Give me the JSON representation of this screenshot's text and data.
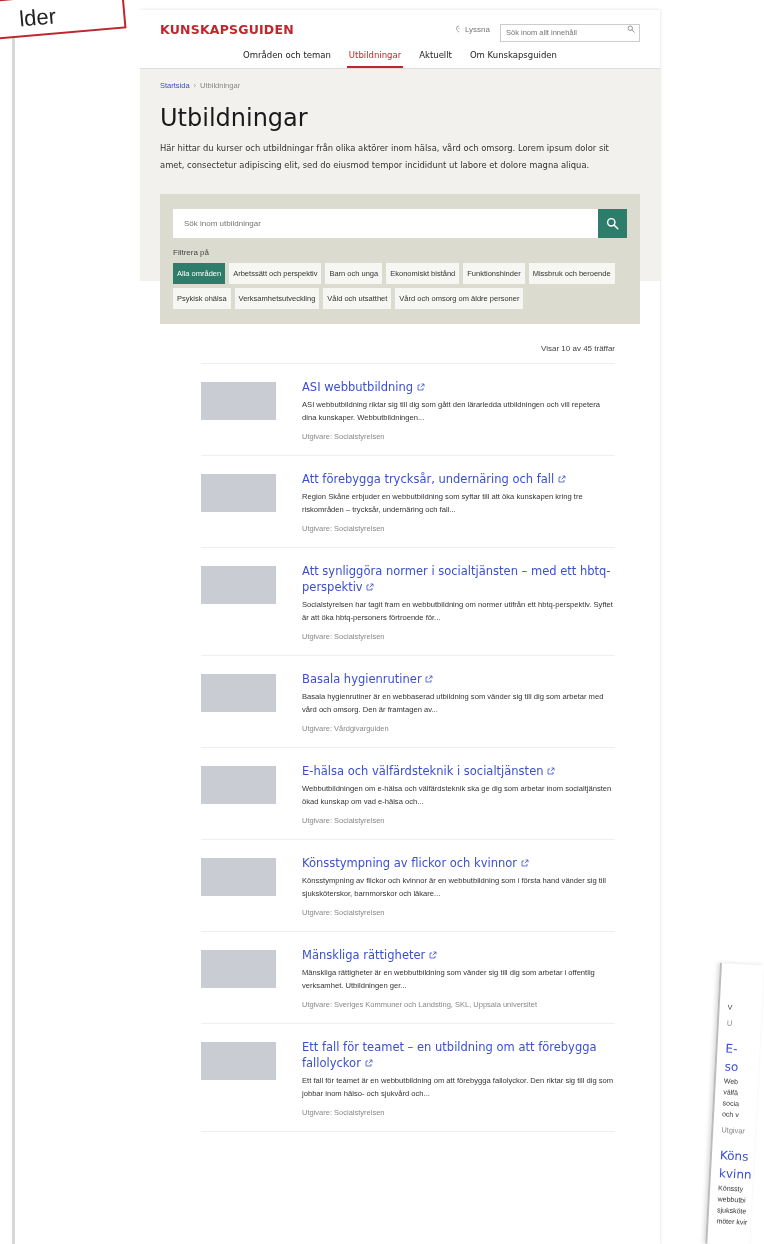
{
  "callout": {
    "text": "lder"
  },
  "header": {
    "logo": "KUNSKAPSGUIDEN",
    "listen": "Lyssna",
    "search": {
      "placeholder": "Sök inom allt innehåll"
    },
    "nav": [
      {
        "label": "Områden och teman",
        "selected": false
      },
      {
        "label": "Utbildningar",
        "selected": true
      },
      {
        "label": "Aktuellt",
        "selected": false
      },
      {
        "label": "Om Kunskapsguiden",
        "selected": false
      }
    ]
  },
  "breadcrumb": {
    "separator": "›",
    "items": [
      {
        "label": "Startsida",
        "current": false
      },
      {
        "label": "Utbildningar",
        "current": true
      }
    ]
  },
  "title": "Utbildningar",
  "intro": "Här hittar du kurser och utbildningar från olika aktörer inom hälsa, vård och omsorg. Lorem ipsum dolor sit amet, consectetur adipiscing elit, sed do eiusmod tempor incididunt ut labore et dolore magna aliqua.",
  "filter": {
    "search": {
      "placeholder": "Sök inom utbildningar"
    },
    "label": "Filtrera på",
    "chips": [
      {
        "label": "Alla områden",
        "selected": true
      },
      {
        "label": "Arbetssätt och perspektiv",
        "selected": false
      },
      {
        "label": "Barn och unga",
        "selected": false
      },
      {
        "label": "Ekonomiskt bistånd",
        "selected": false
      },
      {
        "label": "Funktionshinder",
        "selected": false
      },
      {
        "label": "Missbruk och beroende",
        "selected": false
      },
      {
        "label": "Psykisk ohälsa",
        "selected": false
      },
      {
        "label": "Verksamhetsutveckling",
        "selected": false
      },
      {
        "label": "Våld och utsatthet",
        "selected": false
      },
      {
        "label": "Vård och omsorg om äldre personer",
        "selected": false
      }
    ]
  },
  "results_count": "Visar 10 av 45 träffar",
  "results": [
    {
      "title": "ASI webbutbildning",
      "description": "ASI webbutbildning riktar sig till dig som gått den lärarledda utbildningen och vill repetera dina kunskaper. Webbutbildningen...",
      "publisher": "Utgivare: Socialstyrelsen"
    },
    {
      "title": "Att förebygga trycksår, undernäring och fall",
      "description": "Region Skåne erbjuder en webbutbildning som syftar till att öka kunskapen kring tre riskområden – trycksår, undernäring och fall...",
      "publisher": "Utgivare: Socialstyrelsen"
    },
    {
      "title": "Att synliggöra normer i socialtjänsten – med ett hbtq-perspektiv",
      "description": "Socialstyrelsen har tagit fram en webbutbildning om normer utifrån ett hbtq-perspektiv. Syftet är att öka hbtq-personers förtroende för...",
      "publisher": "Utgivare: Socialstyrelsen"
    },
    {
      "title": "Basala hygienrutiner",
      "description": "Basala hygienrutiner är en webbaserad utbildning som vänder sig till dig som arbetar med vård och omsorg. Den är framtagen av...",
      "publisher": "Utgivare: Vårdgivarguiden"
    },
    {
      "title": "E-hälsa och välfärdsteknik i socialtjänsten",
      "description": "Webbutbildningen om e-hälsa och välfärdsteknik ska ge dig som arbetar inom socialtjänsten ökad kunskap om vad e-hälsa och...",
      "publisher": "Utgivare: Socialstyrelsen"
    },
    {
      "title": "Könsstympning av flickor och kvinnor",
      "description": "Könsstympning av flickor och kvinnor är en webbutbildning som i första hand vänder sig till sjuksköterskor, barnmorskor och läkare...",
      "publisher": "Utgivare: Socialstyrelsen"
    },
    {
      "title": "Mänskliga rättigheter",
      "description": "Mänskliga rättigheter är en webbutbildning som vänder sig till dig som arbetar i offentlig verksamhet. Utbildningen ger...",
      "publisher": "Utgivare: Sveriges Kommuner och Landsting, SKL, Uppsala universitet"
    },
    {
      "title": "Ett fall för teamet – en utbildning om att förebygga fallolyckor",
      "description": "Ett fall för teamet är en webbutbildning om att förebygga fallolyckor. Den riktar sig till dig som jobbar inom hälso- och sjukvård och...",
      "publisher": "Utgivare: Socialstyrelsen"
    }
  ],
  "side_page": [
    {
      "kind": "text",
      "text": "V"
    },
    {
      "kind": "meta",
      "text": "U"
    },
    {
      "kind": "title",
      "text": "E-"
    },
    {
      "kind": "title",
      "text": "so"
    },
    {
      "kind": "text",
      "text": "Web"
    },
    {
      "kind": "text",
      "text": "välfä"
    },
    {
      "kind": "text",
      "text": "socia"
    },
    {
      "kind": "text",
      "text": "och v"
    },
    {
      "kind": "meta",
      "text": "Utgivar"
    },
    {
      "kind": "title",
      "text": "Köns"
    },
    {
      "kind": "title",
      "text": "kvinn"
    },
    {
      "kind": "text",
      "text": "Könssty"
    },
    {
      "kind": "text",
      "text": "webbutbi"
    },
    {
      "kind": "text",
      "text": "sjuksköte"
    },
    {
      "kind": "text",
      "text": "möter kvir"
    }
  ]
}
